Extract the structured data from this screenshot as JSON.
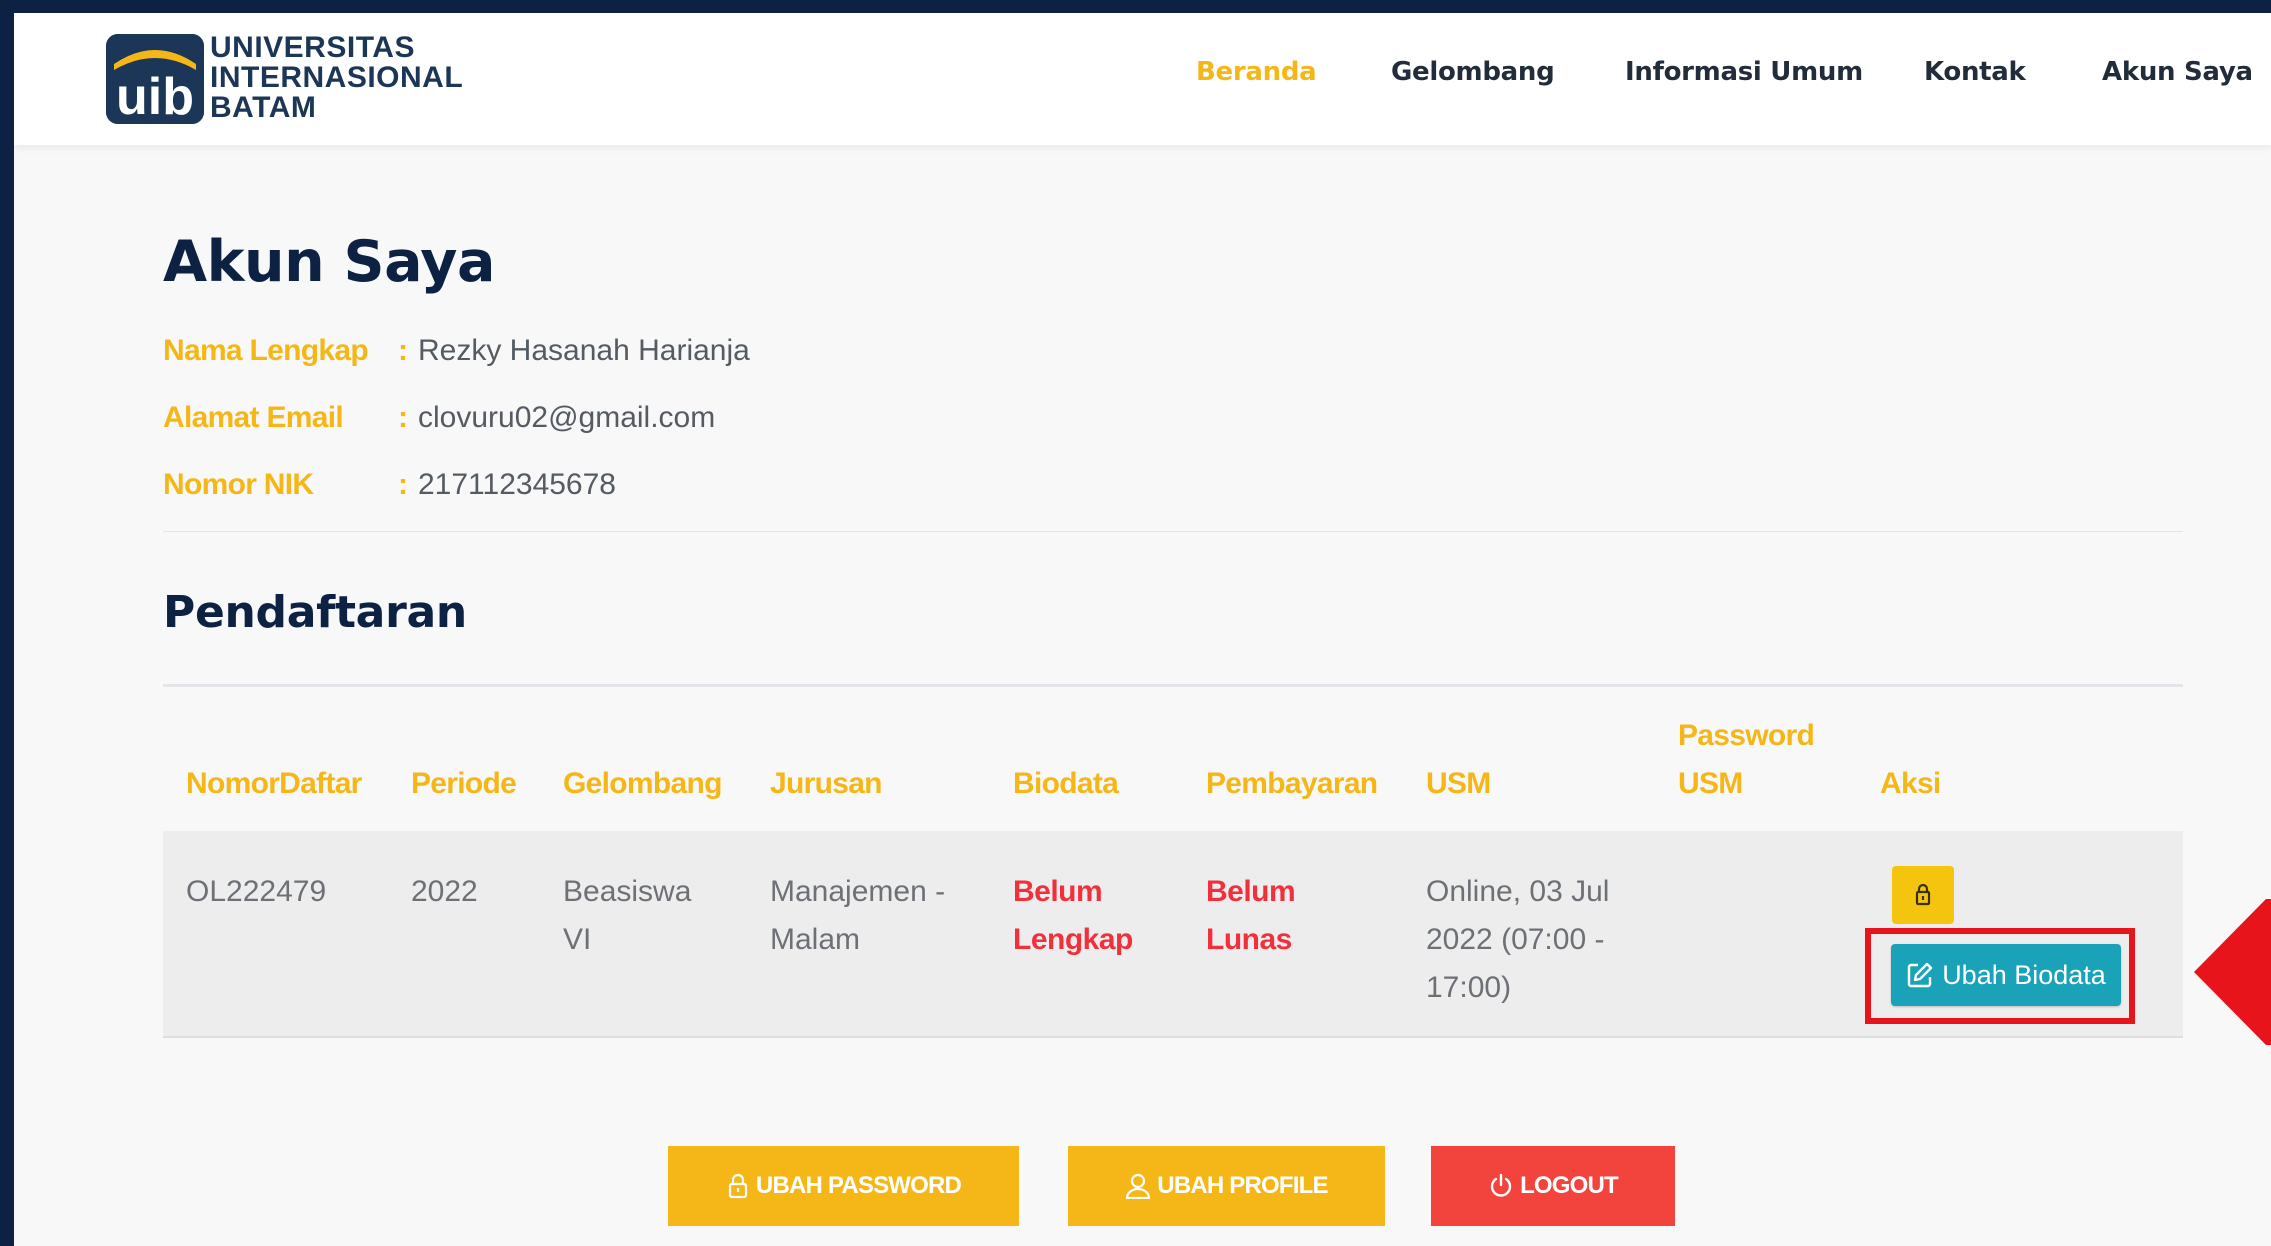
{
  "header": {
    "logo_mark_text": "uib",
    "logo_lines": [
      "UNIVERSITAS",
      "INTERNASIONAL",
      "BATAM"
    ],
    "nav": [
      "Beranda",
      "Gelombang",
      "Informasi Umum",
      "Kontak",
      "Akun Saya"
    ],
    "active_nav": "Beranda"
  },
  "account": {
    "title": "Akun Saya",
    "fields": [
      {
        "label": "Nama Lengkap",
        "value": "Rezky Hasanah Harianja"
      },
      {
        "label": "Alamat Email",
        "value": "clovuru02@gmail.com"
      },
      {
        "label": "Nomor NIK",
        "value": "217112345678"
      }
    ],
    "colon": ":"
  },
  "registration": {
    "title": "Pendaftaran",
    "columns": [
      "NomorDaftar",
      "Periode",
      "Gelombang",
      "Jurusan",
      "Biodata",
      "Pembayaran",
      "USM",
      "Password USM",
      "Aksi"
    ],
    "column_lines": {
      "password_usm": [
        "Password",
        "USM"
      ]
    },
    "row": {
      "nomor_daftar": "OL222479",
      "periode": "2022",
      "gelombang": [
        "Beasiswa",
        "VI"
      ],
      "jurusan": [
        "Manajemen -",
        "Malam"
      ],
      "biodata": [
        "Belum",
        "Lengkap"
      ],
      "pembayaran": [
        "Belum",
        "Lunas"
      ],
      "usm": [
        "Online, 03 Jul",
        "2022 (07:00 -",
        "17:00)"
      ],
      "password_usm": ""
    },
    "actions": {
      "lock_icon": "lock-icon",
      "edit_label": "Ubah Biodata",
      "edit_icon": "edit-icon"
    }
  },
  "buttons": {
    "ubah_password": "UBAH PASSWORD",
    "ubah_profile": "UBAH PROFILE",
    "logout": "LOGOUT"
  },
  "colors": {
    "accent": "#f5b718",
    "navy": "#0d2243",
    "danger": "#f2303b",
    "info": "#1aa3b8",
    "highlight": "#e8141c"
  }
}
